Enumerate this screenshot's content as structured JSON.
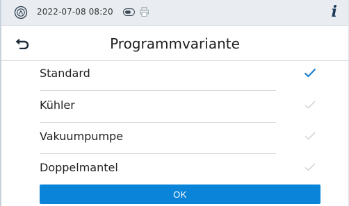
{
  "status": {
    "datetime": "2022-07-08 08:20",
    "info_icon": "i"
  },
  "title": "Programmvariante",
  "options": [
    {
      "label": "Standard",
      "selected": true
    },
    {
      "label": "Kühler",
      "selected": false
    },
    {
      "label": "Vakuumpumpe",
      "selected": false
    },
    {
      "label": "Doppelmantel",
      "selected": false
    }
  ],
  "ok_label": "OK",
  "colors": {
    "accent": "#0a84d9",
    "check_selected": "#1a7fd0",
    "check_unselected": "#d6d6d6",
    "statusbar_bg": "#e9edf1"
  }
}
